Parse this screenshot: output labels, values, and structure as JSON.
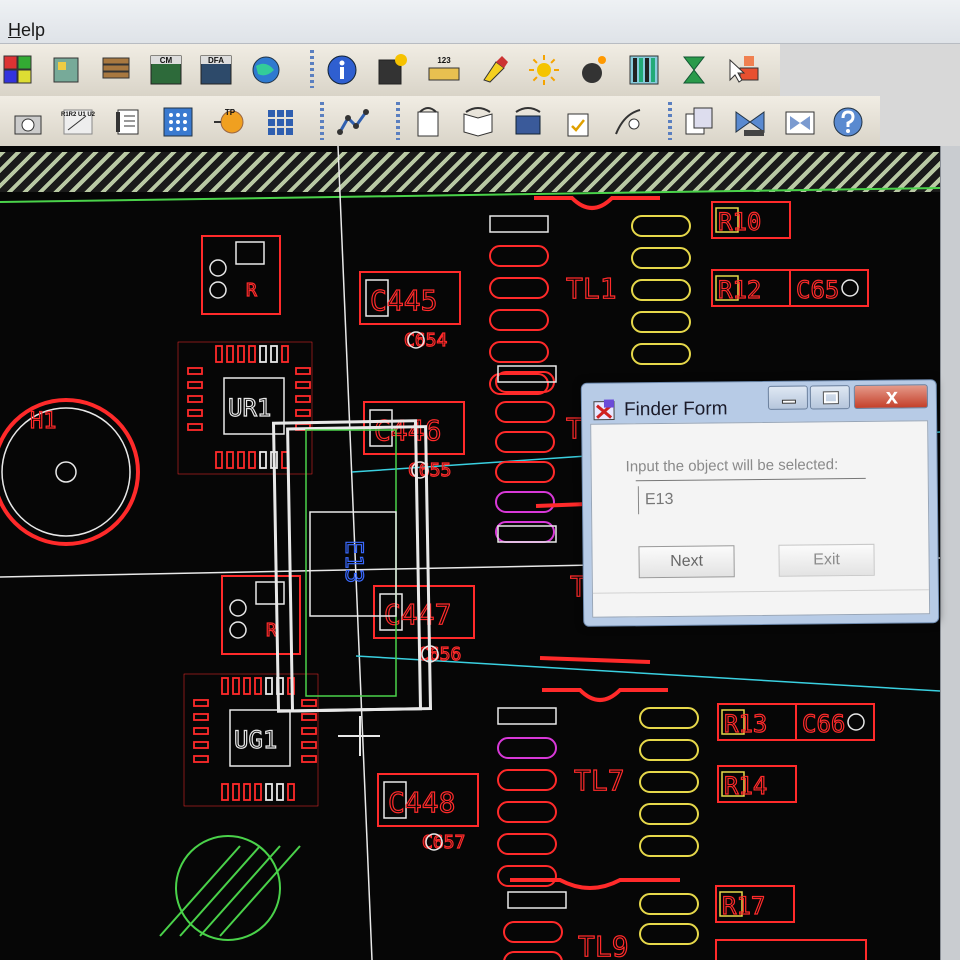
{
  "menu": {
    "help_label": "Help",
    "help_mnemonic": "H",
    "help_rest": "elp"
  },
  "toolbar_top": {
    "buttons": [
      {
        "name": "component-grid-icon"
      },
      {
        "name": "parts-list-icon"
      },
      {
        "name": "bom-stack-icon"
      },
      {
        "name": "cm-table-icon",
        "label": "CM"
      },
      {
        "name": "dfa-table-icon",
        "label": "DFA"
      },
      {
        "name": "globe-icon"
      },
      {
        "name": "info-icon"
      },
      {
        "name": "properties-icon"
      },
      {
        "name": "ruler-123-icon",
        "label": "123"
      },
      {
        "name": "highlight-brush-icon"
      },
      {
        "name": "sun-icon"
      },
      {
        "name": "bomb-icon"
      },
      {
        "name": "layer-bars-icon"
      },
      {
        "name": "hourglass-icon"
      },
      {
        "name": "select-pointer-icon"
      }
    ]
  },
  "toolbar_bottom": {
    "buttons": [
      {
        "name": "camera-icon"
      },
      {
        "name": "renumber-icon",
        "label": "R1R2 U1 U2"
      },
      {
        "name": "document-list-icon"
      },
      {
        "name": "dot-matrix-icon"
      },
      {
        "name": "tp-node-icon",
        "label": "TP"
      },
      {
        "name": "grid-array-icon"
      },
      {
        "name": "route-trace-icon"
      },
      {
        "name": "report-clip-icon"
      },
      {
        "name": "open-book-icon"
      },
      {
        "name": "lock-panel-icon"
      },
      {
        "name": "check-sheet-icon"
      },
      {
        "name": "wire-probe-icon"
      },
      {
        "name": "copy-pages-icon"
      },
      {
        "name": "bowtie-flag-icon"
      },
      {
        "name": "bowtie-box-icon"
      },
      {
        "name": "help-question-icon"
      }
    ]
  },
  "pcb": {
    "labels": {
      "tl1": "TL1",
      "tl7": "TL7",
      "tl9": "TL9",
      "t_a": "T",
      "t_b": "T",
      "ur1": "UR1",
      "ug1": "UG1",
      "hole": "H1",
      "c445": "C445",
      "c446": "C446",
      "c447": "C447",
      "c448": "C448",
      "c654": "C654",
      "c655": "C655",
      "c656": "C656",
      "c657": "C657",
      "r10": "R10",
      "r12": "R12",
      "c65": "C65",
      "r13": "R13",
      "c66": "C66",
      "r14": "R14",
      "r17": "R17",
      "e13": "E13",
      "rb": "R",
      "rb2": "R"
    },
    "colors": {
      "pad": "#ff2a2a",
      "silk": "#e8e8e8",
      "yellow": "#e6d84a",
      "magenta": "#d838d8",
      "green": "#4ad24a",
      "cyan": "#3ad0e0",
      "blue": "#3a6aff"
    }
  },
  "dialog": {
    "title": "Finder Form",
    "prompt": "Input the object will be selected:",
    "input_value": "E13",
    "next_label": "Next",
    "exit_label": "Exit",
    "close_glyph": "x"
  }
}
